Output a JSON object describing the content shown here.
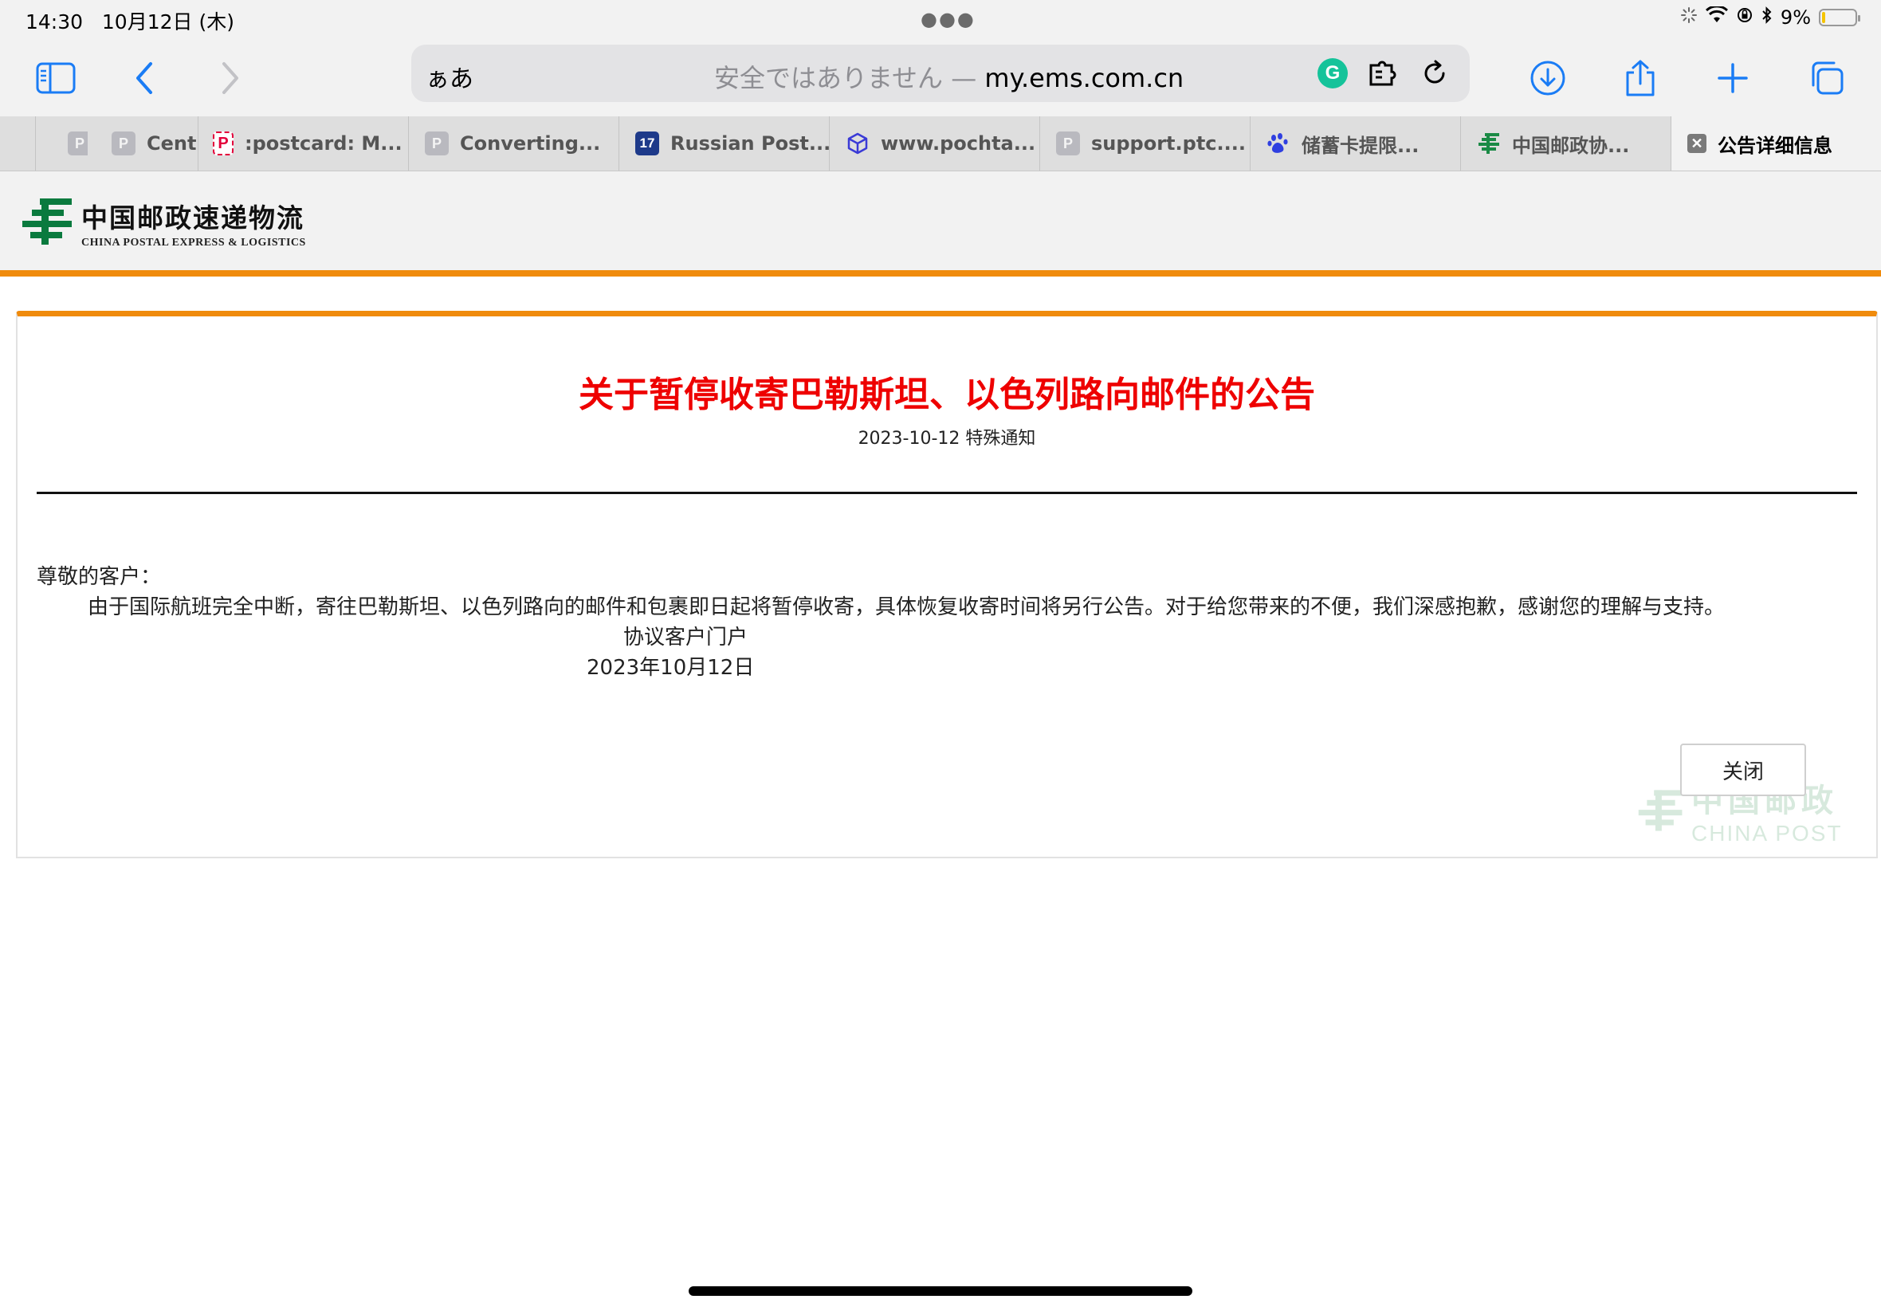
{
  "status_bar": {
    "time": "14:30",
    "date": "10月12日 (木)",
    "battery_percent": "9%",
    "battery_level": 0.09
  },
  "toolbar": {
    "aa_label": "ぁあ",
    "url_security": "安全ではありません — ",
    "url_domain": "my.ems.com.cn"
  },
  "tabs": [
    {
      "label": "",
      "favicon": "P"
    },
    {
      "label": "Centr",
      "favicon": "P"
    },
    {
      "label": ":postcard: M...",
      "favicon": "P"
    },
    {
      "label": "Converting...",
      "favicon": "P"
    },
    {
      "label": "Russian Post...",
      "favicon": "17"
    },
    {
      "label": "www.pochta...",
      "favicon": "cube-icon"
    },
    {
      "label": "support.ptc....",
      "favicon": "P"
    },
    {
      "label": "储蓄卡提限...",
      "favicon": "baidu-paw-icon"
    },
    {
      "label": "中国邮政协...",
      "favicon": "china-post-logo-icon"
    },
    {
      "label": "公告详细信息",
      "favicon": "close-icon",
      "active": true
    }
  ],
  "header": {
    "logo_cn": "中国邮政速递物流",
    "logo_en": "CHINA POSTAL EXPRESS & LOGISTICS",
    "accent_color": "#f08b0c",
    "logo_color": "#0a7a3e"
  },
  "announcement": {
    "title": "关于暂停收寄巴勒斯坦、以色列路向邮件的公告",
    "meta": "2023-10-12 特殊通知",
    "salutation": "尊敬的客户：",
    "body": "由于国际航班完全中断，寄往巴勒斯坦、以色列路向的邮件和包裹即日起将暂停收寄，具体恢复收寄时间将另行公告。对于给您带来的不便，我们深感抱歉，感谢您的理解与支持。",
    "signature": "协议客户门户",
    "date": "2023年10月12日",
    "close_label": "关闭",
    "title_color": "#ee0000"
  },
  "watermark": {
    "cn": "中国邮政",
    "en": "CHINA POST"
  }
}
